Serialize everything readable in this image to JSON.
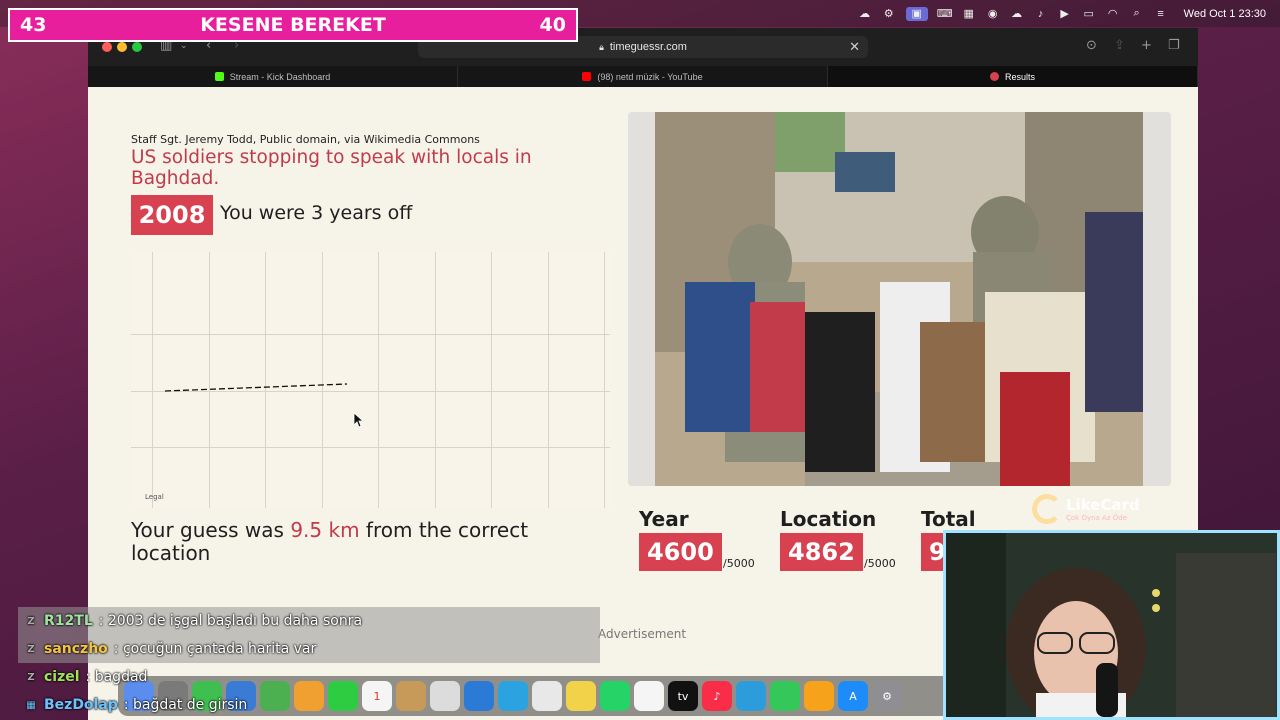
{
  "menubar": {
    "clock": "Wed Oct 1  23:30",
    "icons": [
      "cloud-icon",
      "settings-icon",
      "screen-record-icon",
      "keyboard-icon",
      "grid-icon",
      "creative-cloud-icon",
      "cloud-icon",
      "mic-icon",
      "play-icon",
      "battery-icon",
      "wifi-icon",
      "search-icon",
      "control-center-icon"
    ]
  },
  "banner": {
    "left_score": "43",
    "title": "KESENE BEREKET",
    "right_score": "40"
  },
  "browser": {
    "url": "timeguessr.com",
    "tabs": [
      {
        "label": "Stream - Kick Dashboard",
        "color": "#53fc18"
      },
      {
        "label": "(98) netd müzik - YouTube",
        "color": "#ff0000"
      },
      {
        "label": "Results",
        "color": "#d8414f"
      }
    ]
  },
  "result": {
    "credit": "Staff Sgt. Jeremy Todd, Public domain, via Wikimedia Commons",
    "headline": "US soldiers stopping to speak with locals in Baghdad.",
    "year": "2008",
    "years_off": "You were 3 years off",
    "map_legal": "Legal",
    "guess_prefix": "Your guess was ",
    "guess_km": "9.5 km",
    "guess_suffix": " from the correct location"
  },
  "scores": {
    "year_label": "Year",
    "year_value": "4600",
    "year_max": "/5000",
    "location_label": "Location",
    "location_value": "4862",
    "location_max": "/5000",
    "total_label": "Total",
    "total_value": "9"
  },
  "advertisement": "Advertisement",
  "likecard": {
    "name": "LikeCard",
    "tagline": "Çok Oyna Az Öde"
  },
  "chat": [
    {
      "user": "R12TL",
      "message": ": 2003 de işgal başladı bu daha sonra",
      "color": "#9fe3a0"
    },
    {
      "user": "sanczho",
      "message": ": çocuğun çantada harita var",
      "color": "#f5c542"
    },
    {
      "user": "cizel",
      "message": ": bagdad",
      "color": "#9fe35a"
    },
    {
      "user": "BezDolap",
      "message": ": bağdat de girsin",
      "color": "#6cc2ff"
    }
  ]
}
